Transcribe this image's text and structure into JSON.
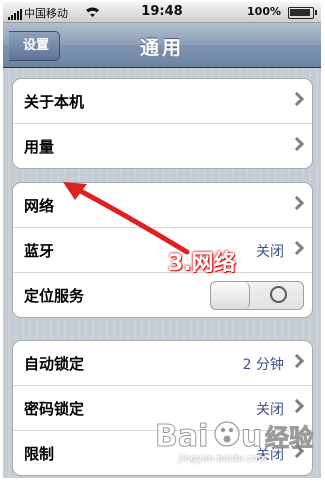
{
  "status_bar": {
    "carrier": "中国移动",
    "time": "19:48",
    "battery": "100%"
  },
  "nav": {
    "back_label": "设置",
    "title": "通用"
  },
  "groups": [
    {
      "rows": [
        {
          "label": "关于本机"
        },
        {
          "label": "用量"
        }
      ]
    },
    {
      "rows": [
        {
          "label": "网络"
        },
        {
          "label": "蓝牙",
          "value": "关闭"
        },
        {
          "label": "定位服务",
          "toggle": "off"
        }
      ]
    },
    {
      "rows": [
        {
          "label": "自动锁定",
          "value": "2 分钟"
        },
        {
          "label": "密码锁定",
          "value": "关闭"
        },
        {
          "label": "限制",
          "value": "关闭"
        }
      ]
    }
  ],
  "annotation": {
    "text": "3.网络",
    "color": "#e02020"
  },
  "watermark": {
    "logo": "Baidu经验",
    "url": "jingyan.baidu.com"
  }
}
